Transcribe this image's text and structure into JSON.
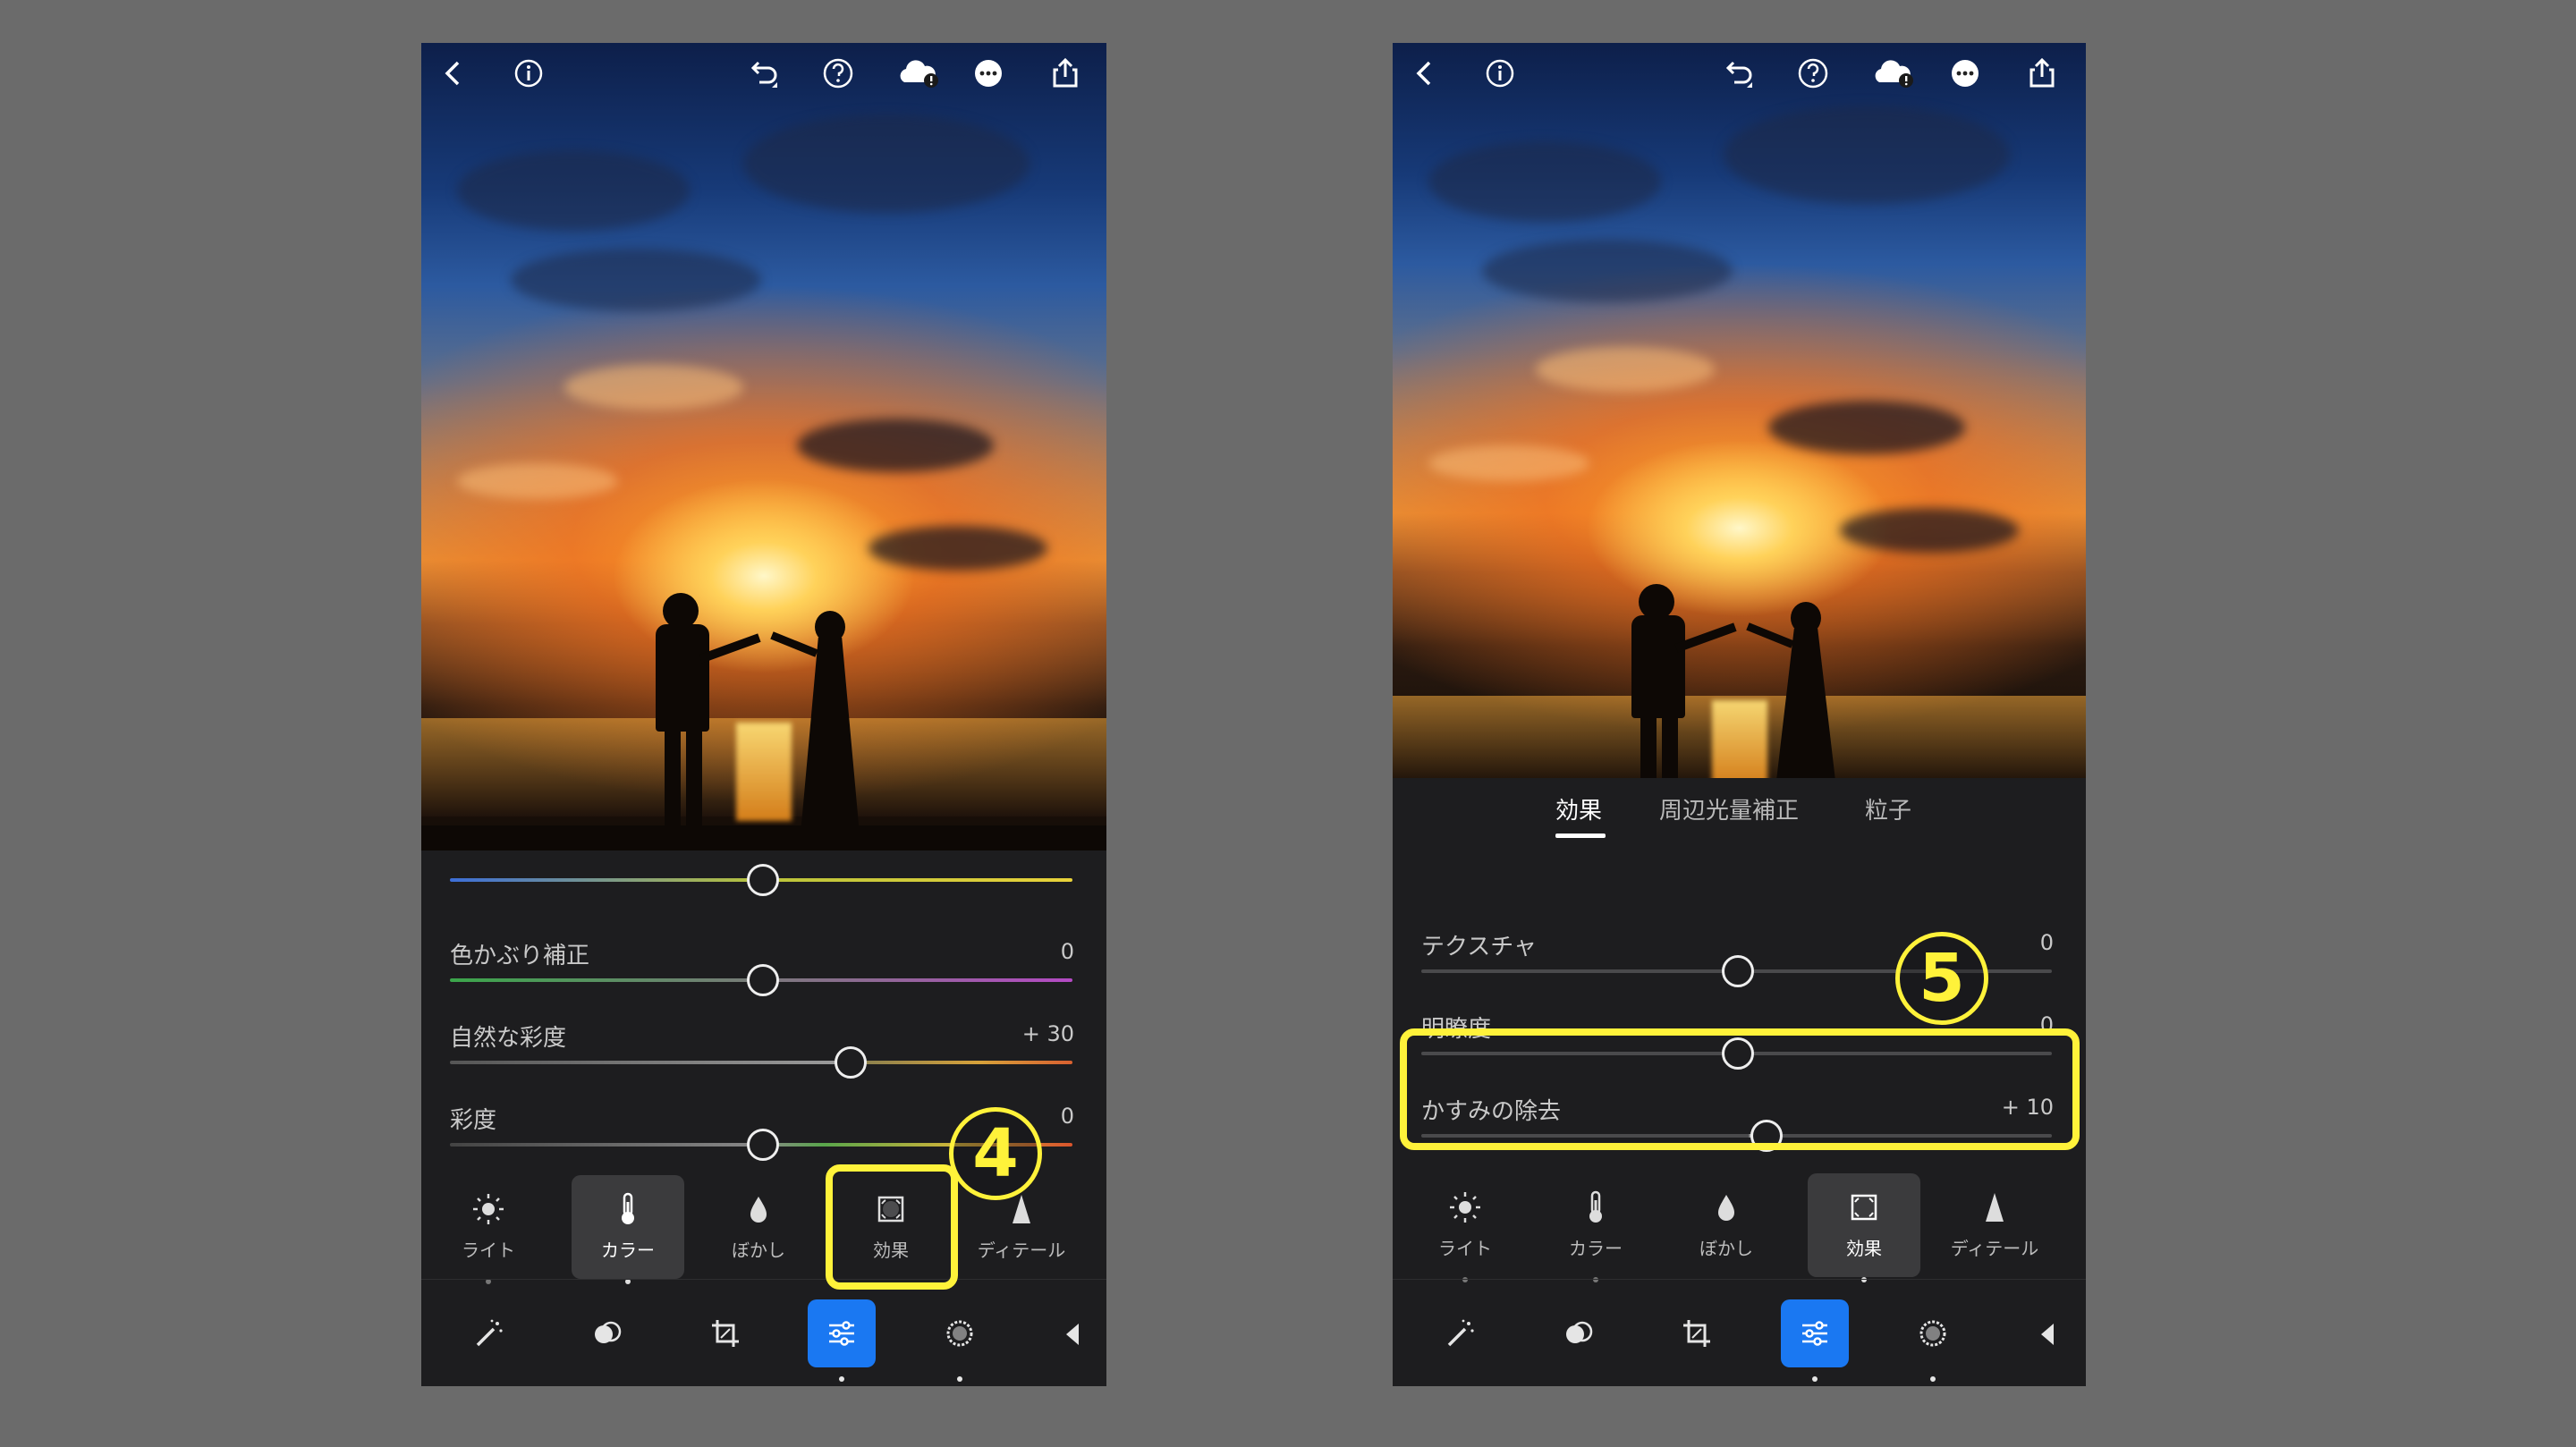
{
  "colors": {
    "background": "#6b6b6b",
    "panel": "#1d1d1f",
    "accent": "#1a78f2",
    "highlight": "#fff23a"
  },
  "top_bar_icons": [
    "back-icon",
    "info-icon",
    "undo-icon",
    "help-icon",
    "cloud-sync-icon",
    "more-icon",
    "share-icon"
  ],
  "left": {
    "sliders": [
      {
        "label": "",
        "value": "",
        "position": 0.5
      },
      {
        "label": "色かぶり補正",
        "value": "0",
        "position": 0.5
      },
      {
        "label": "自然な彩度",
        "value": "+ 30",
        "position": 0.65
      },
      {
        "label": "彩度",
        "value": "0",
        "position": 0.5
      }
    ],
    "tools": [
      {
        "icon": "sun-icon",
        "label": "ライト",
        "active": false
      },
      {
        "icon": "thermometer-icon",
        "label": "カラー",
        "active": true
      },
      {
        "icon": "drop-icon",
        "label": "ぼかし",
        "active": false
      },
      {
        "icon": "vignette-icon",
        "label": "効果",
        "active": false
      },
      {
        "icon": "triangle-icon",
        "label": "ディテール",
        "active": false
      }
    ],
    "step": "4"
  },
  "right": {
    "tabs": [
      "効果",
      "周辺光量補正",
      "粒子"
    ],
    "active_tab": "効果",
    "sliders": [
      {
        "label": "テクスチャ",
        "value": "0",
        "position": 0.5
      },
      {
        "label": "明瞭度",
        "value": "0",
        "position": 0.5
      },
      {
        "label": "かすみの除去",
        "value": "+ 10",
        "position": 0.55
      }
    ],
    "tools": [
      {
        "icon": "sun-icon",
        "label": "ライト",
        "active": false
      },
      {
        "icon": "thermometer-icon",
        "label": "カラー",
        "active": false
      },
      {
        "icon": "drop-icon",
        "label": "ぼかし",
        "active": false
      },
      {
        "icon": "vignette-icon",
        "label": "効果",
        "active": true
      },
      {
        "icon": "triangle-icon",
        "label": "ディテール",
        "active": false
      }
    ],
    "step": "5"
  },
  "bottom_tools": [
    "auto-wand-icon",
    "mask-icon",
    "crop-icon",
    "adjust-icon",
    "presets-icon",
    "more-tools-icon"
  ]
}
